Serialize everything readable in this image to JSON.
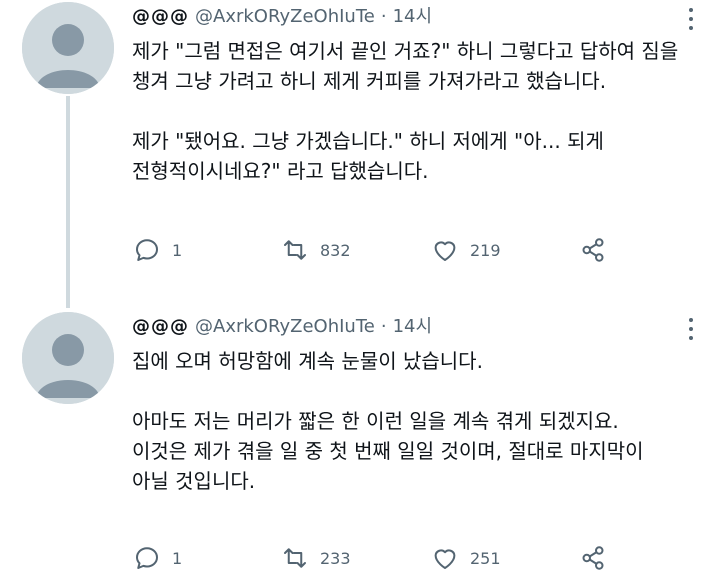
{
  "tweets": [
    {
      "display_name": "@@@",
      "handle": "@AxrkORyZeOhIuTe",
      "separator": "·",
      "time": "14시",
      "paragraphs": [
        [
          "제가 \"그럼 면접은 여기서 끝인 거죠?\" 하니 그렇다고 답하여 짐을",
          "챙겨 그냥 가려고 하니 제게 커피를 가져가라고 했습니다."
        ],
        [
          "제가 \"됐어요. 그냥 가겠습니다.\" 하니 저에게 \"아... 되게",
          "전형적이시네요?\" 라고 답했습니다."
        ]
      ],
      "replies": "1",
      "retweets": "832",
      "likes": "219"
    },
    {
      "display_name": "@@@",
      "handle": "@AxrkORyZeOhIuTe",
      "separator": "·",
      "time": "14시",
      "paragraphs": [
        [
          "집에 오며 허망함에 계속 눈물이 났습니다."
        ],
        [
          "아마도 저는 머리가 짧은 한 이런 일을 계속 겪게 되겠지요.",
          "이것은 제가 겪을 일 중 첫 번째 일일 것이며, 절대로 마지막이",
          "아닐 것입니다."
        ]
      ],
      "replies": "1",
      "retweets": "233",
      "likes": "251"
    }
  ]
}
